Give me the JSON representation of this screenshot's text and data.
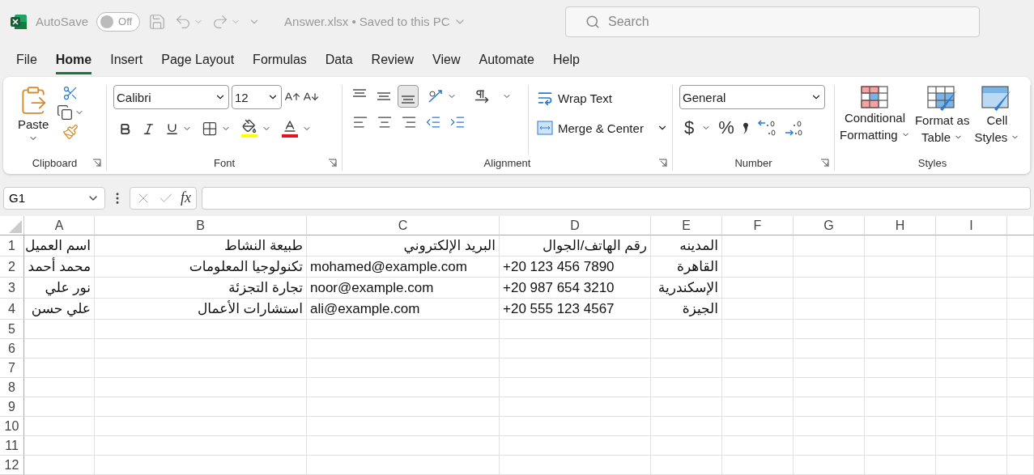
{
  "title_bar": {
    "autosave_label": "AutoSave",
    "autosave_toggle": {
      "label": "Off",
      "on": false
    },
    "document_title": "Answer.xlsx • Saved to this PC",
    "search_placeholder": "Search"
  },
  "menu_tabs": [
    {
      "label": "File",
      "selected": false
    },
    {
      "label": "Home",
      "selected": true
    },
    {
      "label": "Insert",
      "selected": false
    },
    {
      "label": "Page Layout",
      "selected": false
    },
    {
      "label": "Formulas",
      "selected": false
    },
    {
      "label": "Data",
      "selected": false
    },
    {
      "label": "Review",
      "selected": false
    },
    {
      "label": "View",
      "selected": false
    },
    {
      "label": "Automate",
      "selected": false
    },
    {
      "label": "Help",
      "selected": false
    }
  ],
  "ribbon": {
    "clipboard": {
      "paste_label": "Paste",
      "group_label": "Clipboard"
    },
    "font": {
      "font_name": "Calibri",
      "font_size": "12",
      "group_label": "Font"
    },
    "alignment": {
      "vertical_align": [
        {
          "selected": false
        },
        {
          "selected": false
        },
        {
          "selected": true
        }
      ],
      "wrap_text": "Wrap Text",
      "merge_center": "Merge & Center",
      "group_label": "Alignment"
    },
    "number": {
      "format": "General",
      "currency": "$",
      "percent": "%",
      "group_label": "Number"
    },
    "styles": {
      "buttons": [
        {
          "line1": "Conditional",
          "line2": "Formatting",
          "kind": "conditional"
        },
        {
          "line1": "Format as",
          "line2": "Table",
          "kind": "table"
        },
        {
          "line1": "Cell",
          "line2": "Styles",
          "kind": "cell"
        }
      ],
      "group_label": "Styles"
    }
  },
  "formula_bar": {
    "name_box": "G1",
    "function_label": "fx"
  },
  "sheet": {
    "columns": [
      "A",
      "B",
      "C",
      "D",
      "E",
      "F",
      "G",
      "H",
      "I"
    ],
    "rows": [
      {
        "number": "1",
        "cells": [
          "اسم العميل",
          "طبيعة النشاط",
          "البريد الإلكتروني",
          "رقم الهاتف/الجوال",
          "المدينه"
        ]
      },
      {
        "number": "2",
        "cells": [
          "محمد أحمد",
          "تكنولوجيا المعلومات",
          "mohamed@example.com",
          "+20 123 456 7890",
          "القاهرة"
        ]
      },
      {
        "number": "3",
        "cells": [
          "نور علي",
          "تجارة التجزئة",
          "noor@example.com",
          "+20 987 654 3210",
          "الإسكندرية"
        ]
      },
      {
        "number": "4",
        "cells": [
          "علي حسن",
          "استشارات الأعمال",
          "ali@example.com",
          "+20 555 123 4567",
          "الجيزة"
        ]
      },
      {
        "number": "5",
        "cells": []
      },
      {
        "number": "6",
        "cells": []
      },
      {
        "number": "7",
        "cells": []
      },
      {
        "number": "8",
        "cells": []
      },
      {
        "number": "9",
        "cells": []
      },
      {
        "number": "10",
        "cells": []
      },
      {
        "number": "11",
        "cells": []
      },
      {
        "number": "12",
        "cells": []
      }
    ]
  }
}
